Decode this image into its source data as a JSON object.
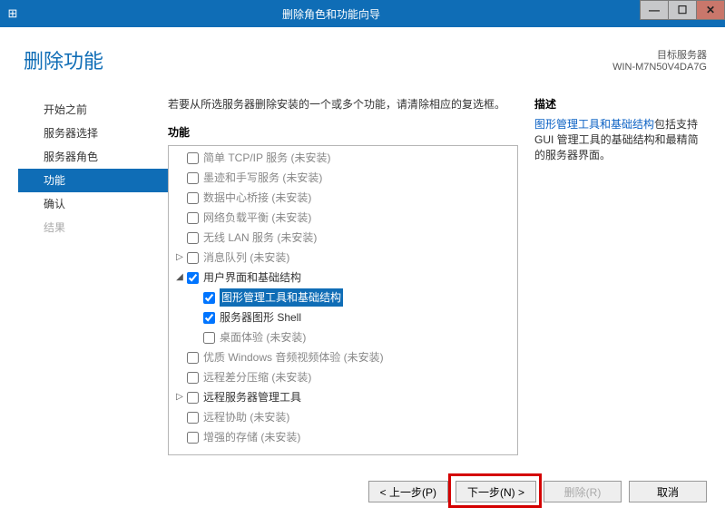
{
  "window": {
    "title": "删除角色和功能向导"
  },
  "header": {
    "page_title": "删除功能",
    "dest_label": "目标服务器",
    "dest_value": "WIN-M7N50V4DA7G"
  },
  "sidebar": {
    "items": [
      {
        "label": "开始之前",
        "state": "normal"
      },
      {
        "label": "服务器选择",
        "state": "normal"
      },
      {
        "label": "服务器角色",
        "state": "normal"
      },
      {
        "label": "功能",
        "state": "active"
      },
      {
        "label": "确认",
        "state": "normal"
      },
      {
        "label": "结果",
        "state": "disabled"
      }
    ]
  },
  "main": {
    "intro": "若要从所选服务器删除安装的一个或多个功能，请清除相应的复选框。",
    "features_label": "功能",
    "desc_label": "描述",
    "desc_link": "图形管理工具和基础结构",
    "desc_rest": "包括支持 GUI 管理工具的基础结构和最精简的服务器界面。",
    "tree": [
      {
        "label": "简单 TCP/IP 服务",
        "suffix": "(未安装)",
        "notinst": true,
        "indent": 0
      },
      {
        "label": "墨迹和手写服务",
        "suffix": "(未安装)",
        "notinst": true,
        "indent": 0
      },
      {
        "label": "数据中心桥接",
        "suffix": "(未安装)",
        "notinst": true,
        "indent": 0
      },
      {
        "label": "网络负载平衡",
        "suffix": "(未安装)",
        "notinst": true,
        "indent": 0
      },
      {
        "label": "无线 LAN 服务",
        "suffix": "(未安装)",
        "notinst": true,
        "indent": 0
      },
      {
        "label": "消息队列",
        "suffix": "(未安装)",
        "notinst": true,
        "indent": 0,
        "expander": "▷"
      },
      {
        "label": "用户界面和基础结构",
        "suffix": "",
        "notinst": false,
        "indent": 0,
        "expander": "◢",
        "checked": true
      },
      {
        "label": "图形管理工具和基础结构",
        "suffix": "",
        "notinst": false,
        "indent": 1,
        "selected": true,
        "checked": true
      },
      {
        "label": "服务器图形 Shell",
        "suffix": "",
        "notinst": false,
        "indent": 1,
        "checked": true
      },
      {
        "label": "桌面体验",
        "suffix": "(未安装)",
        "notinst": true,
        "indent": 1
      },
      {
        "label": "优质 Windows 音频视频体验",
        "suffix": "(未安装)",
        "notinst": true,
        "indent": 0
      },
      {
        "label": "远程差分压缩",
        "suffix": "(未安装)",
        "notinst": true,
        "indent": 0
      },
      {
        "label": "远程服务器管理工具",
        "suffix": "",
        "notinst": false,
        "indent": 0,
        "expander": "▷"
      },
      {
        "label": "远程协助",
        "suffix": "(未安装)",
        "notinst": true,
        "indent": 0
      },
      {
        "label": "增强的存储",
        "suffix": "(未安装)",
        "notinst": true,
        "indent": 0
      }
    ]
  },
  "buttons": {
    "prev": "< 上一步(P)",
    "next": "下一步(N) >",
    "remove": "删除(R)",
    "cancel": "取消"
  }
}
